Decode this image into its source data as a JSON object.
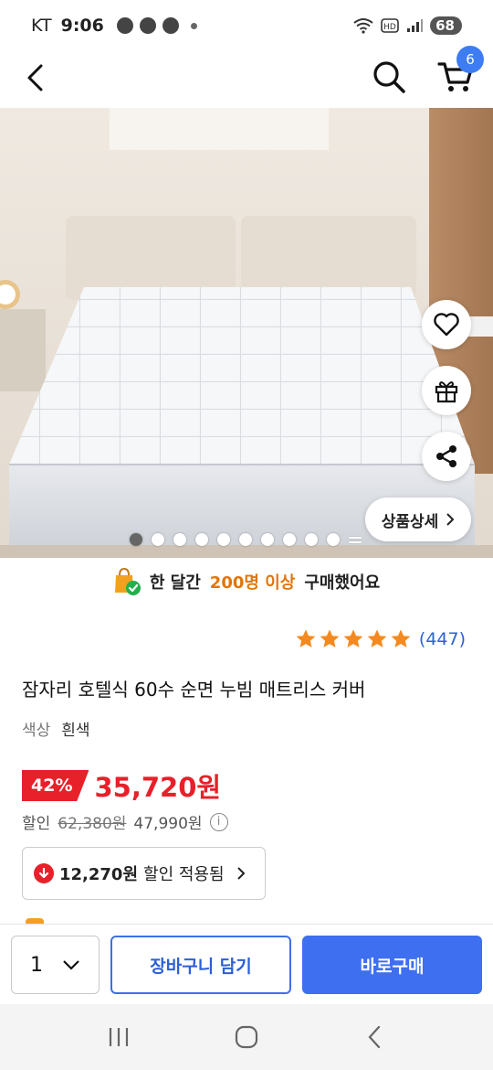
{
  "status_bar": {
    "carrier": "KT",
    "time": "9:06",
    "battery": "68"
  },
  "header": {
    "back_icon": "chevron-left-icon",
    "search_icon": "search-icon",
    "cart_icon": "cart-icon",
    "cart_count": "6"
  },
  "gallery": {
    "image": "white quilted mattress topper on bed",
    "image_count": 10,
    "active_index": 0,
    "detail_button": "상품상세",
    "side_buttons": [
      "heart-icon",
      "gift-icon",
      "share-icon"
    ]
  },
  "purchase_banner": {
    "prefix": "한 달간",
    "highlight": "200명 이상",
    "suffix": "구매했어요"
  },
  "rating": {
    "stars": 5,
    "review_count": "(447)"
  },
  "product": {
    "title": "잠자리 호텔식 60수 순면 누빔 매트리스 커버",
    "option_label": "색상",
    "option_value": "흰색"
  },
  "price": {
    "discount": "42%",
    "sale": "35,720원",
    "discount_label": "할인",
    "original": "62,380원",
    "member_price": "47,990원"
  },
  "coupon": {
    "amount": "12,270원",
    "text": "할인 적용됨"
  },
  "action_bar": {
    "quantity": "1",
    "cart_button": "장바구니 담기",
    "buy_button": "바로구매"
  },
  "colors": {
    "accent_blue": "#3d6ff0",
    "sale_red": "#e8202a",
    "highlight_orange": "#e0760a",
    "star_orange": "#f48a1f"
  }
}
